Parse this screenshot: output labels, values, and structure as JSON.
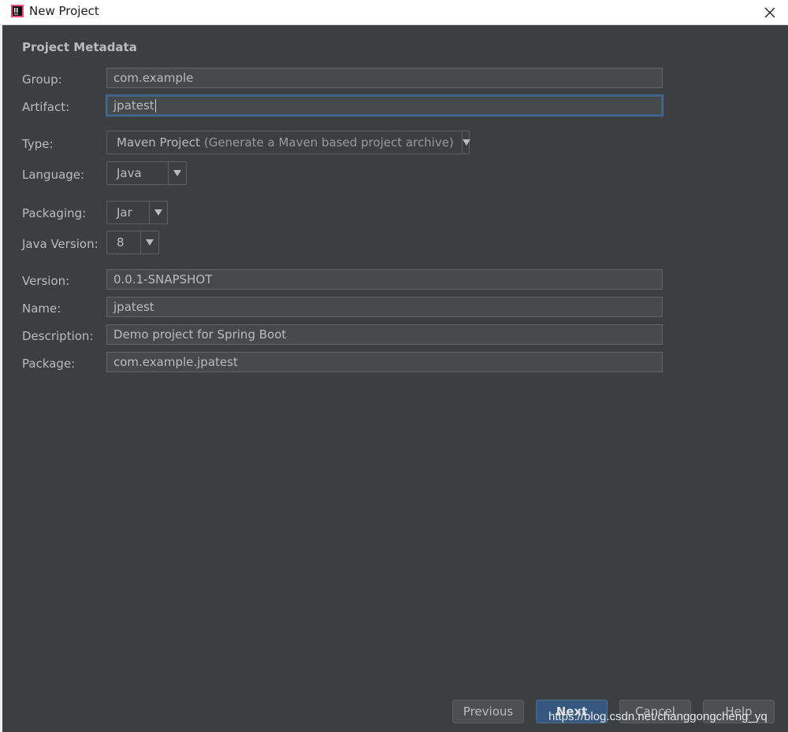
{
  "window": {
    "title": "New Project"
  },
  "section": {
    "title": "Project Metadata"
  },
  "form": {
    "group": {
      "label": "Group:",
      "value": "com.example"
    },
    "artifact": {
      "label": "Artifact:",
      "value": "jpatest"
    },
    "type": {
      "label": "Type:",
      "value": "Maven Project",
      "hint": "(Generate a Maven based project archive)"
    },
    "language": {
      "label": "Language:",
      "value": "Java"
    },
    "packaging": {
      "label": "Packaging:",
      "value": "Jar"
    },
    "java_version": {
      "label": "Java Version:",
      "value": "8"
    },
    "version": {
      "label": "Version:",
      "value": "0.0.1-SNAPSHOT"
    },
    "name": {
      "label": "Name:",
      "value": "jpatest"
    },
    "description": {
      "label": "Description:",
      "value": "Demo project for Spring Boot"
    },
    "package": {
      "label": "Package:",
      "value": "com.example.jpatest"
    }
  },
  "buttons": {
    "previous": "Previous",
    "next": "Next",
    "cancel": "Cancel",
    "help": "Help"
  },
  "watermark": "https://blog.csdn.net/changgongcheng_yq",
  "icons": {
    "app": "intellij-idea-icon",
    "close": "close-icon",
    "dropdown": "dropdown-arrow-icon"
  },
  "colors": {
    "background": "#3c3f41",
    "field_background": "#45494a",
    "focus_border": "#3d6185",
    "primary_button": "#365880",
    "text": "#bbbbbb"
  }
}
